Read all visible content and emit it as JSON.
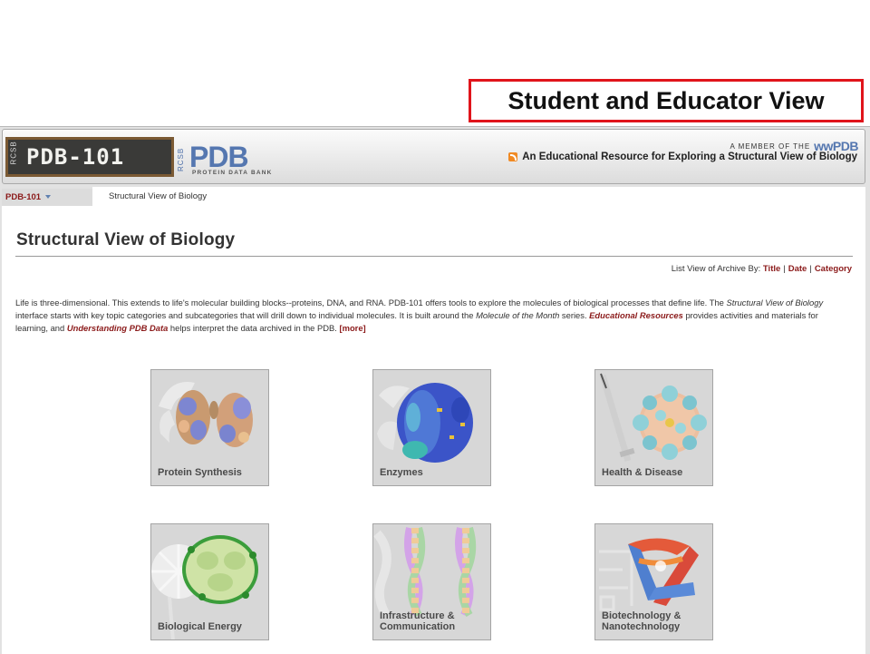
{
  "callout": {
    "text": "Student and Educator View"
  },
  "header": {
    "logo_text": "PDB-101",
    "rcsb": "RCSB",
    "pdb_logo": "PDB",
    "pdb_subtitle": "PROTEIN DATA BANK",
    "member_text": "A MEMBER OF THE",
    "member_logo": "wwPDB",
    "tagline": "An Educational Resource for Exploring a Structural View of Biology"
  },
  "nav": {
    "menu_label": "PDB-101",
    "breadcrumb": "Structural View of Biology"
  },
  "main": {
    "title": "Structural View of Biology",
    "archive": {
      "prefix": "List View of Archive By:",
      "links": [
        "Title",
        "Date",
        "Category"
      ]
    },
    "intro": {
      "s1": "Life is three-dimensional. This extends to life's molecular building blocks--proteins, DNA, and RNA. PDB-101 offers tools to explore the molecules of biological processes that define life. The ",
      "s2": "Structural View of Biology",
      "s3": " interface starts with key topic categories and subcategories that will drill down to individual molecules. It is built around the ",
      "s4": "Molecule of the Month",
      "s5": " series. ",
      "link1": "Educational Resources",
      "s6": " provides activities and materials for learning, and ",
      "link2": "Understanding PDB Data",
      "s7": " helps interpret the data archived in the PDB. ",
      "more": "[more]"
    },
    "categories": [
      {
        "label": "Protein Synthesis"
      },
      {
        "label": "Enzymes"
      },
      {
        "label": "Health & Disease"
      },
      {
        "label": "Biological Energy"
      },
      {
        "label_line1": "Infrastructure &",
        "label_line2": "Communication"
      },
      {
        "label_line1": "Biotechnology &",
        "label_line2": "Nanotechnology"
      }
    ]
  },
  "colors": {
    "callout_border": "#e0141b",
    "link": "#8b1a1a",
    "pdb_blue": "#5577b0",
    "card_bg": "#d7d7d7"
  }
}
